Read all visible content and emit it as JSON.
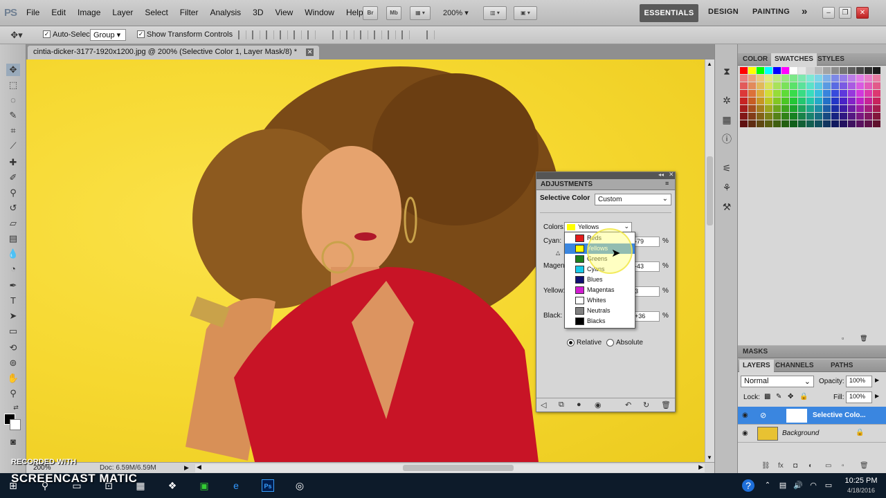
{
  "app": {
    "logo": "PS",
    "menus": [
      "File",
      "Edit",
      "Image",
      "Layer",
      "Select",
      "Filter",
      "Analysis",
      "3D",
      "View",
      "Window",
      "Help"
    ],
    "bridge_btn": "Br",
    "minibridge_btn": "Mb",
    "zoom": "200%",
    "workspaces": [
      "ESSENTIALS",
      "DESIGN",
      "PAINTING"
    ],
    "more_workspaces": "»"
  },
  "options": {
    "auto_select_label": "Auto-Select:",
    "auto_select_value": "Group",
    "transform_label": "Show Transform Controls"
  },
  "document": {
    "tab_title": "cintia-dicker-3177-1920x1200.jpg @ 200% (Selective Color 1, Layer Mask/8) *",
    "status_zoom": "200%",
    "status_doc": "Doc: 6.59M/6.59M"
  },
  "adjustments": {
    "panel_title": "ADJUSTMENTS",
    "preset_label": "Selective Color",
    "preset_value": "Custom",
    "colors_label": "Colors:",
    "colors_value": "Yellows",
    "sliders": [
      {
        "label": "Cyan:",
        "value": "-79"
      },
      {
        "label": "Magenta:",
        "value": "-43"
      },
      {
        "label": "Yellow:",
        "value": "3"
      },
      {
        "label": "Black:",
        "value": "+36"
      }
    ],
    "pct": "%",
    "relative_label": "Relative",
    "absolute_label": "Absolute",
    "dropdown": [
      {
        "label": "Reds",
        "color": "#e21b1b"
      },
      {
        "label": "Yellows",
        "color": "#ffff00"
      },
      {
        "label": "Greens",
        "color": "#1e7f1e"
      },
      {
        "label": "Cyans",
        "color": "#18c8e8"
      },
      {
        "label": "Blues",
        "color": "#101070"
      },
      {
        "label": "Magentas",
        "color": "#d11cd1"
      },
      {
        "label": "Whites",
        "color": "#ffffff"
      },
      {
        "label": "Neutrals",
        "color": "#808080"
      },
      {
        "label": "Blacks",
        "color": "#000000"
      }
    ]
  },
  "panels": {
    "swatch_tabs": [
      "COLOR",
      "SWATCHES",
      "STYLES"
    ],
    "masks_tab": "MASKS",
    "layer_tabs": [
      "LAYERS",
      "CHANNELS",
      "PATHS"
    ],
    "blend_mode": "Normal",
    "opacity_label": "Opacity:",
    "opacity_value": "100%",
    "lock_label": "Lock:",
    "fill_label": "Fill:",
    "fill_value": "100%",
    "layers": [
      {
        "name": "Selective Colo...",
        "selected": true
      },
      {
        "name": "Background",
        "selected": false
      }
    ]
  },
  "taskbar": {
    "ps_label": "Ps",
    "time": "10:25 PM",
    "date": "4/18/2016"
  },
  "watermark": {
    "recorded": "RECORDED WITH",
    "brand": "SCREENCAST MATIC"
  }
}
